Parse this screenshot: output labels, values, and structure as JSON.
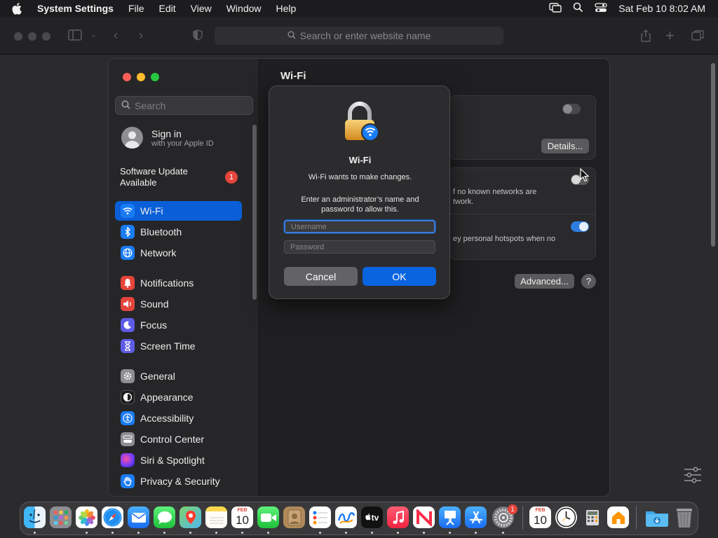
{
  "menubar": {
    "app_name": "System Settings",
    "menus": [
      "File",
      "Edit",
      "View",
      "Window",
      "Help"
    ],
    "datetime": "Sat Feb 10  8:02 AM"
  },
  "browser": {
    "url_placeholder": "Search or enter website name"
  },
  "sidebar": {
    "search_placeholder": "Search",
    "account": {
      "title": "Sign in",
      "subtitle": "with your Apple ID"
    },
    "software_update": {
      "label": "Software Update Available",
      "badge": "1"
    },
    "items": [
      {
        "label": "Wi-Fi",
        "icon": "wifi-icon",
        "color": "#1a7cf5",
        "selected": true
      },
      {
        "label": "Bluetooth",
        "icon": "bluetooth-icon",
        "color": "#1a7cf5"
      },
      {
        "label": "Network",
        "icon": "globe-icon",
        "color": "#1a7cf5"
      },
      {
        "label": "Notifications",
        "icon": "bell-icon",
        "color": "#e5453b"
      },
      {
        "label": "Sound",
        "icon": "speaker-icon",
        "color": "#e5453b"
      },
      {
        "label": "Focus",
        "icon": "moon-icon",
        "color": "#5e5ce6"
      },
      {
        "label": "Screen Time",
        "icon": "hourglass-icon",
        "color": "#5e5ce6"
      },
      {
        "label": "General",
        "icon": "gear-icon",
        "color": "#8e8e93"
      },
      {
        "label": "Appearance",
        "icon": "appearance-icon",
        "color": "#1c1c1e"
      },
      {
        "label": "Accessibility",
        "icon": "accessibility-icon",
        "color": "#1a7cf5"
      },
      {
        "label": "Control Center",
        "icon": "control-center-icon",
        "color": "#8e8e93"
      },
      {
        "label": "Siri & Spotlight",
        "icon": "siri-icon",
        "color": "#b03fd0"
      },
      {
        "label": "Privacy & Security",
        "icon": "hand-icon",
        "color": "#1a7cf5"
      }
    ]
  },
  "pane": {
    "title": "Wi-Fi",
    "details_label": "Details...",
    "ask_join_text_1": "f no known networks are",
    "ask_join_text_2": "twork.",
    "hotspot_text": "ey personal hotspots when no",
    "advanced_label": "Advanced...",
    "help_label": "?",
    "wifi_toggle_on": false,
    "ask_join_on": false,
    "hotspot_on": true
  },
  "dialog": {
    "title": "Wi-Fi",
    "subtitle": "Wi-Fi wants to make changes.",
    "message": "Enter an administrator’s name and password to allow this.",
    "username_placeholder": "Username",
    "password_placeholder": "Password",
    "cancel_label": "Cancel",
    "ok_label": "OK"
  },
  "dock": {
    "calendar_month": "FEB",
    "calendar_day": "10",
    "tv_label": "tv",
    "settings_badge": "1",
    "apps": [
      "finder-icon",
      "launchpad-icon",
      "photos-icon",
      "safari-icon",
      "mail-icon",
      "messages-icon",
      "maps-icon",
      "notes-icon",
      "facetime-icon",
      "contacts-icon",
      "reminders-icon",
      "freeform-icon",
      "tv-icon",
      "music-icon",
      "news-icon",
      "keynote-icon",
      "app-store-icon",
      "system-settings-icon",
      "calendar-icon",
      "clock-icon",
      "calculator-icon",
      "home-icon",
      "downloads-folder-icon",
      "trash-icon"
    ]
  },
  "colors": {
    "accent": "#0a64e0",
    "selection": "#0a5fd8",
    "badge": "#e5453b"
  }
}
